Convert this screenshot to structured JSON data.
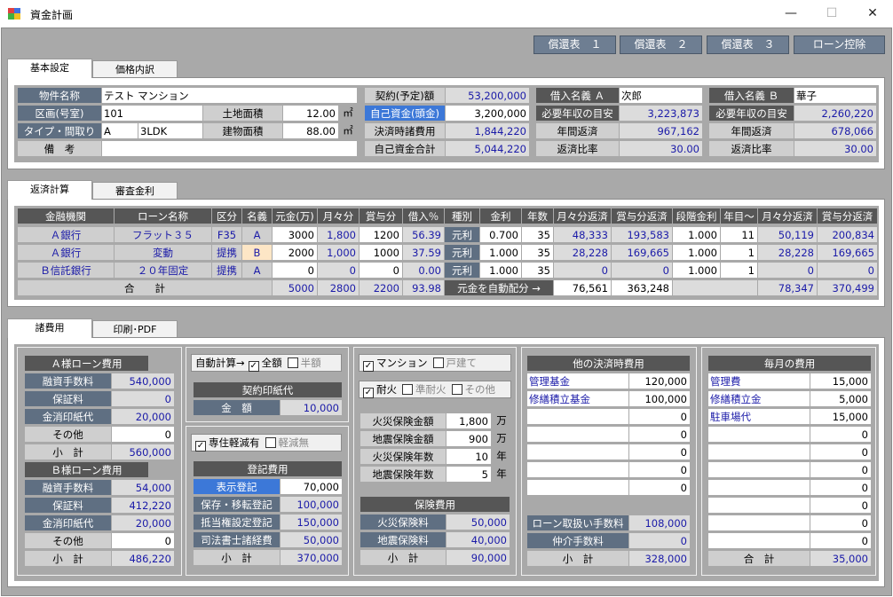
{
  "window": {
    "title": "資金計画",
    "min": "—",
    "max": "☐",
    "close": "✕"
  },
  "top_buttons": [
    "償還表　１",
    "償還表　２",
    "償還表　３",
    "ローン控除"
  ],
  "tabs1": [
    "基本設定",
    "価格内訳"
  ],
  "basic": {
    "property_name_label": "物件名称",
    "property_name": "テスト マンション",
    "room_label": "区画(号室)",
    "room": "101",
    "land_area_label": "土地面積",
    "land_area": "12.00",
    "unit_m2": "㎡",
    "type_label": "タイプ・間取り",
    "type": "A",
    "layout": "3LDK",
    "building_area_label": "建物面積",
    "building_area": "88.00",
    "remarks_label": "備　考",
    "remarks": "",
    "contract_label": "契約(予定)額",
    "contract": "53,200,000",
    "own_funds_label": "自己資金(頭金)",
    "own_funds": "3,200,000",
    "settlement_label": "決済時諸費用",
    "settlement": "1,844,220",
    "own_total_label": "自己資金合計",
    "own_total": "5,044,220",
    "borrowerA_label": "借入名義 Ａ",
    "borrowerA": "次郎",
    "borrowerB_label": "借入名義 Ｂ",
    "borrowerB": "華子",
    "income_label": "必要年収の目安",
    "incomeA": "3,223,873",
    "incomeB": "2,260,220",
    "annual_label": "年間返済",
    "annualA": "967,162",
    "annualB": "678,066",
    "ratio_label": "返済比率",
    "ratioA": "30.00",
    "ratioB": "30.00"
  },
  "tabs2": [
    "返済計算",
    "審査金利"
  ],
  "loan_table": {
    "headers": [
      "金融機関",
      "ローン名称",
      "区分",
      "名義",
      "元金(万)",
      "月々分",
      "賞与分",
      "借入％",
      "種別",
      "金利",
      "年数",
      "月々分返済",
      "賞与分返済",
      "段階金利",
      "年目～",
      "月々分返済",
      "賞与分返済"
    ],
    "rows": [
      [
        "Ａ銀行",
        "フラット３５",
        "F35",
        "A",
        "3000",
        "1,800",
        "1200",
        "56.39",
        "元利",
        "0.700",
        "35",
        "48,333",
        "193,583",
        "1.000",
        "11",
        "50,119",
        "200,834"
      ],
      [
        "Ａ銀行",
        "変動",
        "提携",
        "B",
        "2000",
        "1,000",
        "1000",
        "37.59",
        "元利",
        "1.000",
        "35",
        "28,228",
        "169,665",
        "1.000",
        "1",
        "28,228",
        "169,665"
      ],
      [
        "Ｂ信託銀行",
        "２０年固定",
        "提携",
        "A",
        "0",
        "0",
        "0",
        "0.00",
        "元利",
        "1.000",
        "35",
        "0",
        "0",
        "1.000",
        "1",
        "0",
        "0"
      ]
    ],
    "total_label": "合　　計",
    "total_principal": "5000",
    "total_monthly": "2800",
    "total_bonus": "2200",
    "total_pct": "93.98",
    "auto_label": "元金を自動配分 →",
    "total_mpay": "76,561",
    "total_bpay": "363,248",
    "total_mpay2": "78,347",
    "total_bpay2": "370,499"
  },
  "tabs3": [
    "諸費用",
    "印刷･PDF"
  ],
  "feesA": {
    "title": "Ａ様ローン費用",
    "items": [
      [
        "融資手数料",
        "540,000"
      ],
      [
        "保証料",
        "0"
      ],
      [
        "金消印紙代",
        "20,000"
      ],
      [
        "その他",
        "0"
      ]
    ],
    "subtotal_label": "小　計",
    "subtotal": "560,000"
  },
  "feesB": {
    "title": "Ｂ様ローン費用",
    "items": [
      [
        "融資手数料",
        "54,000"
      ],
      [
        "保証料",
        "412,220"
      ],
      [
        "金消印紙代",
        "20,000"
      ],
      [
        "その他",
        "0"
      ]
    ],
    "subtotal_label": "小　計",
    "subtotal": "486,220"
  },
  "auto_calc": {
    "label": "自動計算→",
    "full": "全額",
    "half": "半額"
  },
  "stamp": {
    "title": "契約印紙代",
    "label": "金　額",
    "value": "10,000"
  },
  "reduction": {
    "yes": "専住軽減有",
    "no": "軽減無"
  },
  "registration": {
    "title": "登記費用",
    "items": [
      [
        "表示登記",
        "70,000"
      ],
      [
        "保存・移転登記",
        "100,000"
      ],
      [
        "抵当権設定登記",
        "150,000"
      ],
      [
        "司法書士諸経費",
        "50,000"
      ]
    ],
    "subtotal_label": "小　計",
    "subtotal": "370,000"
  },
  "building_type": {
    "mansion": "マンション",
    "house": "戸建て"
  },
  "fireproof": {
    "fire": "耐火",
    "semi": "準耐火",
    "other": "その他"
  },
  "insurance_inputs": [
    [
      "火災保険金額",
      "1,800",
      "万"
    ],
    [
      "地震保険金額",
      "900",
      "万"
    ],
    [
      "火災保険年数",
      "10",
      "年"
    ],
    [
      "地震保険年数",
      "5",
      "年"
    ]
  ],
  "insurance": {
    "title": "保険費用",
    "items": [
      [
        "火災保険料",
        "50,000"
      ],
      [
        "地震保険料",
        "40,000"
      ]
    ],
    "subtotal_label": "小　計",
    "subtotal": "90,000"
  },
  "other_settlement": {
    "title": "他の決済時費用",
    "items": [
      [
        "管理基金",
        "120,000"
      ],
      [
        "修繕積立基金",
        "100,000"
      ],
      [
        "",
        "0"
      ],
      [
        "",
        "0"
      ],
      [
        "",
        "0"
      ],
      [
        "",
        "0"
      ],
      [
        "",
        "0"
      ]
    ],
    "loan_fee_label": "ローン取扱い手数料",
    "loan_fee": "108,000",
    "broker_label": "仲介手数料",
    "broker": "0",
    "subtotal_label": "小　計",
    "subtotal": "328,000"
  },
  "monthly": {
    "title": "毎月の費用",
    "items": [
      [
        "管理費",
        "15,000"
      ],
      [
        "修繕積立金",
        "5,000"
      ],
      [
        "駐車場代",
        "15,000"
      ],
      [
        "",
        "0"
      ],
      [
        "",
        "0"
      ],
      [
        "",
        "0"
      ],
      [
        "",
        "0"
      ],
      [
        "",
        "0"
      ],
      [
        "",
        "0"
      ],
      [
        "",
        "0"
      ]
    ],
    "total_label": "合　計",
    "total": "35,000"
  }
}
